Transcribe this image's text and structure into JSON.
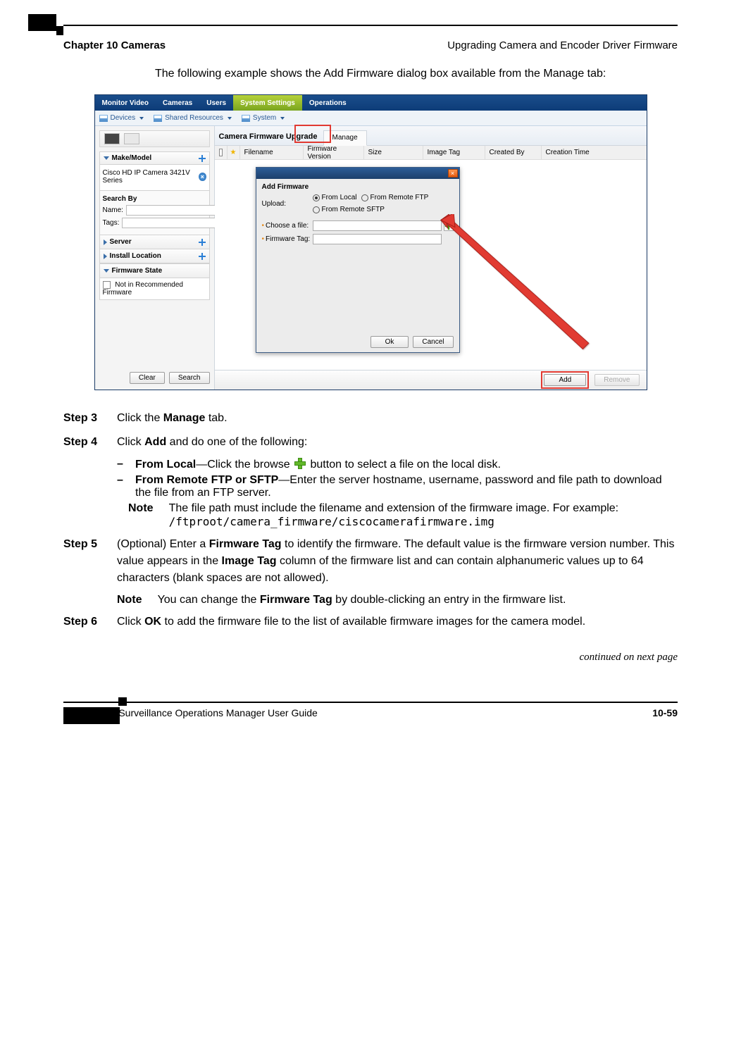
{
  "header": {
    "chapter": "Chapter 10      Cameras",
    "section": "Upgrading Camera and Encoder Driver Firmware"
  },
  "intro": "The following example shows the Add Firmware dialog box available from the Manage tab:",
  "screenshot": {
    "topnav": {
      "tabs": [
        "Monitor Video",
        "Cameras",
        "Users",
        "System Settings",
        "Operations"
      ],
      "active_index": 3
    },
    "subnav": [
      "Devices",
      "Shared Resources",
      "System"
    ],
    "left": {
      "make_model": {
        "title": "Make/Model",
        "item": "Cisco HD IP Camera 3421V Series"
      },
      "search_by": {
        "title": "Search By",
        "name_label": "Name:",
        "tags_label": "Tags:"
      },
      "server": "Server",
      "install_location": "Install Location",
      "firmware_state": {
        "title": "Firmware State",
        "opt": "Not in Recommended Firmware"
      },
      "buttons": {
        "clear": "Clear",
        "search": "Search"
      }
    },
    "right": {
      "title": "Camera Firmware Upgrade",
      "tab": "Manage",
      "columns": [
        "Filename",
        "Firmware Version",
        "Size",
        "Image Tag",
        "Created By",
        "Creation Time"
      ],
      "footer": {
        "add": "Add",
        "remove": "Remove"
      }
    },
    "dialog": {
      "title": "Add Firmware",
      "upload_label": "Upload:",
      "radios": [
        "From Local",
        "From Remote FTP",
        "From Remote SFTP"
      ],
      "choose_file": "Choose a file:",
      "fw_tag": "Firmware Tag:",
      "ok": "Ok",
      "cancel": "Cancel"
    }
  },
  "steps": {
    "three": {
      "label": "Step 3",
      "text": "Click the Manage tab."
    },
    "four": {
      "label": "Step 4",
      "lead": "Click Add and do one of the following:",
      "optA": "From Local—Click the browse  button to select a file on the local disk.",
      "optB": "From Remote FTP or SFTP—Enter the server hostname, username, password and file path to download the file from an FTP server.",
      "note_label": "Note",
      "note_text": "The file path must include the filename and extension of the firmware image. For example: /ftproot/camera_firmware/ciscocamerafirmware.img"
    },
    "five": {
      "label": "Step 5",
      "lead": "(Optional) Enter a Firmware Tag to identify the firmware. The default value is the firmware version number. This value appears in the Image Tag column of the firmware list and can contain alphanumeric values up to 64 characters (blank spaces are not allowed).",
      "note_label": "Note",
      "note_text": "You can change the Firmware Tag by double-clicking an entry in the firmware list."
    },
    "six": {
      "label": "Step 6",
      "lead": "Click OK to add the firmware file to the list of available firmware images for the camera model."
    }
  },
  "continued": "continued on next page",
  "footer": {
    "doc_title": "Cisco Video Surveillance Operations Manager User Guide",
    "page": "10-59"
  }
}
